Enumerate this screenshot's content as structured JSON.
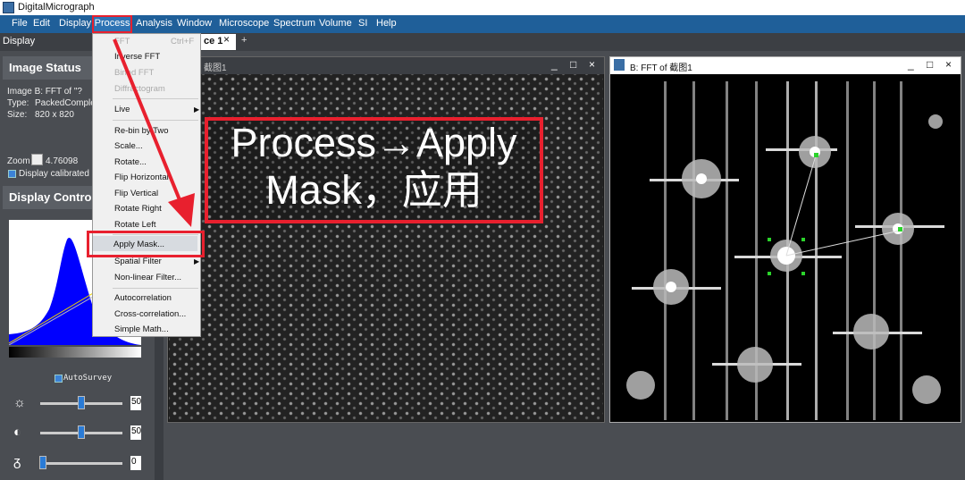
{
  "app": {
    "title": "DigitalMicrograph"
  },
  "menubar": [
    "File",
    "Edit",
    "Display",
    "Process",
    "Analysis",
    "Window",
    "Microscope",
    "Spectrum",
    "Volume",
    "SI",
    "Help"
  ],
  "tabbar": {
    "display_label": "Display",
    "doc_tab": "ce 1",
    "close_glyph": "×",
    "add_glyph": "+"
  },
  "image_status": {
    "header": "Image Status",
    "name": "Image B: FFT of \"?",
    "type_label": "Type:",
    "type_value": "PackedComplex",
    "size_label": "Size:",
    "size_value": "820 x 820",
    "zoom_label": "Zoom",
    "zoom_value": "4.76098",
    "calibrated": "Display calibrated u"
  },
  "display_control": {
    "header": "Display Control",
    "autosurvey": "AutoSurvey",
    "brightness": "50",
    "contrast": "50",
    "gamma": "0"
  },
  "windowA": {
    "title": "截图1",
    "buttons": [
      "_",
      "□",
      "×"
    ]
  },
  "windowB": {
    "title": "B: FFT of 截图1",
    "buttons": [
      "_",
      "□",
      "×"
    ]
  },
  "process_menu": {
    "fft": "FFT",
    "fft_shortcut": "Ctrl+F",
    "inverse": "Inverse FFT",
    "bined": "Bined FFT",
    "diff": "Diffractogram",
    "live": "Live",
    "rebin": "Re-bin by Two",
    "scale": "Scale...",
    "rotate": "Rotate...",
    "fliph": "Flip Horizontal",
    "flipv": "Flip Vertical",
    "rotr": "Rotate Right",
    "rotl": "Rotate Left",
    "apply": "Apply Mask...",
    "spatial": "Spatial Filter",
    "nonlin": "Non-linear Filter...",
    "auto": "Autocorrelation",
    "cross": "Cross-correlation...",
    "simple": "Simple Math..."
  },
  "annotation": {
    "line1": "Process→Apply",
    "line2": "Mask，应用",
    "accent": "#e8202e"
  }
}
